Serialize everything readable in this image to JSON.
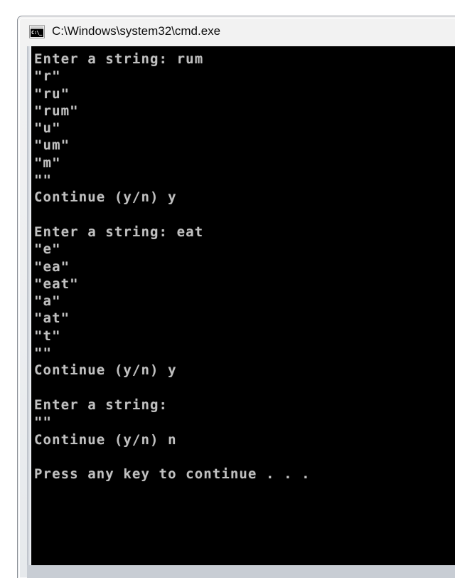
{
  "window": {
    "title": "C:\\Windows\\system32\\cmd.exe",
    "icon_name": "cmd-icon",
    "icon_glyph": "C:\\_",
    "background_color": "#000000",
    "foreground_color": "#c0c0c0",
    "titlebar_color": "#eceef0"
  },
  "console": {
    "lines": [
      "Enter a string: rum",
      "\"r\"",
      "\"ru\"",
      "\"rum\"",
      "\"u\"",
      "\"um\"",
      "\"m\"",
      "\"\"",
      "Continue (y/n) y",
      "",
      "Enter a string: eat",
      "\"e\"",
      "\"ea\"",
      "\"eat\"",
      "\"a\"",
      "\"at\"",
      "\"t\"",
      "\"\"",
      "Continue (y/n) y",
      "",
      "Enter a string:",
      "\"\"",
      "Continue (y/n) n",
      "",
      "Press any key to continue . . ."
    ]
  }
}
